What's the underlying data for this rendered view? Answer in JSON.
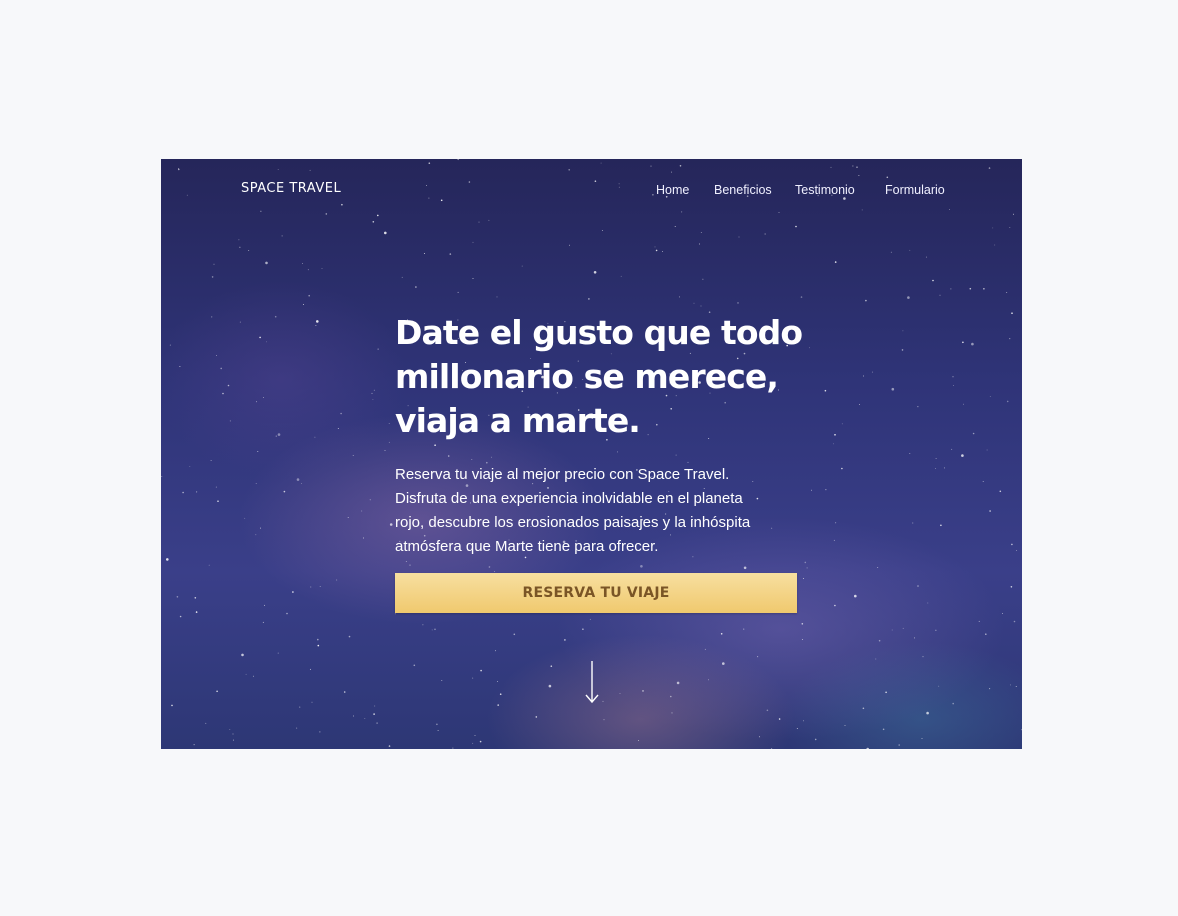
{
  "brand": "SPACE TRAVEL",
  "nav": {
    "items": [
      "Home",
      "Beneficios",
      "Testimonio",
      "Formulario"
    ]
  },
  "hero": {
    "headline": "Date el gusto que todo millonario se merece, viaja a marte.",
    "description": "Reserva tu viaje al mejor precio con Space Travel. Disfruta de una experiencia inolvidable en el planeta rojo, descubre los erosionados paisajes y la inhóspita atmósfera que Marte tiene para ofrecer.",
    "cta_label": "RESERVA TU VIAJE",
    "scroll_icon": "arrow-down-icon"
  },
  "colors": {
    "page_background": "#f7f8fa",
    "hero_background": "#2f3478",
    "cta_background": "#f0c96e",
    "cta_text": "#7a5526",
    "text": "#ffffff"
  }
}
